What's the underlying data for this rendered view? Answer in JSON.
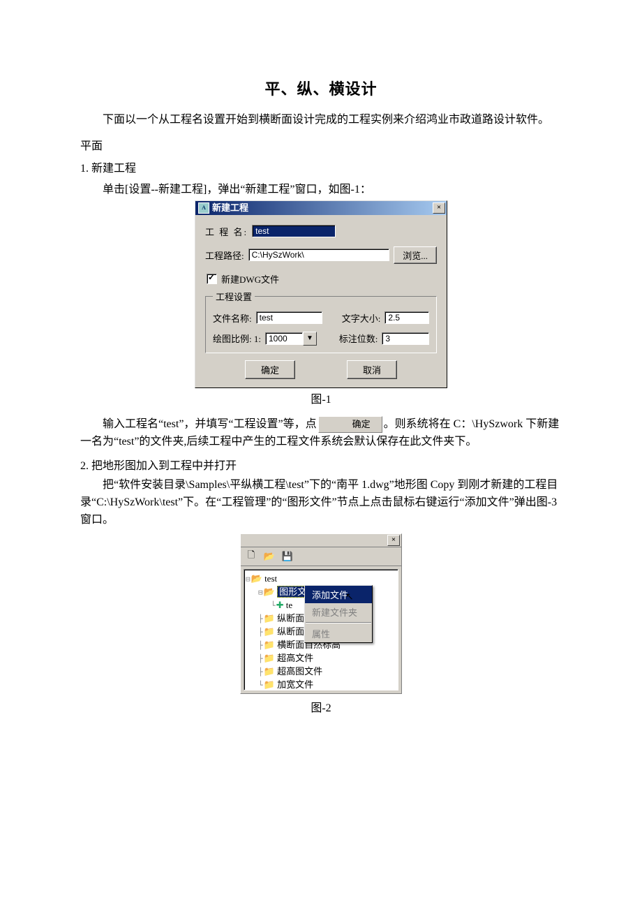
{
  "doc": {
    "title": "平、纵、横设计",
    "intro": "下面以一个从工程名设置开始到横断面设计完成的工程实例来介绍鸿业市政道路设计软件。",
    "sec_plane": "平面",
    "step1_heading": "1. 新建工程",
    "step1_line": "单击[设置--新建工程]，弹出“新建工程”窗口，如图-1：",
    "fig1_caption": "图-1",
    "para2_pre": "输入工程名“test”，并填写“工程设置”等，点",
    "para2_btn": "确定",
    "para2_post": "。则系统将在 C：\\HySzwork 下新建一名为“test”的文件夹,后续工程中产生的工程文件系统会默认保存在此文件夹下。",
    "step2_heading": "2. 把地形图加入到工程中并打开",
    "step2_para": "把“软件安装目录\\Samples\\平纵横工程\\test”下的“南平 1.dwg”地形图 Copy 到刚才新建的工程目录“C:\\HySzWork\\test”下。在“工程管理”的“图形文件”节点上点击鼠标右键运行“添加文件”弹出图-3 窗口。",
    "fig2_caption": "图-2"
  },
  "dialog1": {
    "title": "新建工程",
    "close_glyph": "×",
    "lbl_projname": "工 程 名:",
    "val_projname": "test",
    "lbl_projpath": "工程路径:",
    "val_projpath": "C:\\HySzWork\\",
    "btn_browse": "浏览...",
    "chk_newdwg": "新建DWG文件",
    "group_legend": "工程设置",
    "lbl_filename": "文件名称:",
    "val_filename": "test",
    "lbl_textsize": "文字大小:",
    "val_textsize": "2.5",
    "lbl_scale": "绘图比例: 1:",
    "val_scale": "1000",
    "lbl_digits": "标注位数:",
    "val_digits": "3",
    "btn_ok": "确定",
    "btn_cancel": "取消"
  },
  "panel2": {
    "close_glyph": "×",
    "toolbar": {
      "new": "🗋",
      "open": "📂",
      "save": "💾"
    },
    "root": "test",
    "sel_node": "图形文",
    "child_te": "te",
    "items": [
      "纵断面",
      "纵断面",
      "横断面自然标高",
      "超高文件",
      "超高图文件",
      "加宽文件"
    ],
    "menu": {
      "add": "添加文件",
      "newfolder": "新建文件夹",
      "prop": "属性"
    },
    "cursor": "↖"
  }
}
